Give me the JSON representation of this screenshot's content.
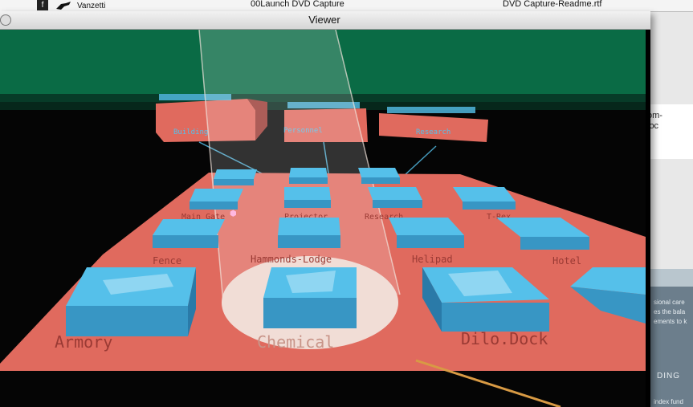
{
  "background": {
    "top_icon_letter": "f",
    "top_item_vanzetti": "Vanzetti",
    "top_item_launch": "00Launch DVD Capture",
    "top_item_readme": "DVD Capture-Readme.rtf",
    "side_text_1": "om-",
    "side_text_2": "loc",
    "side_text_3": "sional care",
    "side_text_4": "es the bala",
    "side_text_5": "ements to k",
    "side_heading": "DING",
    "side_footer": "index fund"
  },
  "viewer": {
    "title": "Viewer"
  },
  "scene": {
    "colors": {
      "floor": "#e06a5e",
      "box_top": "#55c0ea",
      "box_side": "#3896c4",
      "sky": "#0a6b45",
      "building": "#e06a5e"
    },
    "building_labels": [
      "Building",
      "Personnel",
      "Research"
    ],
    "front_labels": [
      "Armory",
      "Chemical",
      "Dilo.Dock"
    ],
    "row2_labels": [
      "Fence",
      "Hammonds-Lodge",
      "Helipad",
      "Hotel"
    ],
    "row3_labels": [
      "Main Gate",
      "Projector",
      "Research",
      "T-Rex"
    ],
    "cursor_symbol": "⬢"
  }
}
